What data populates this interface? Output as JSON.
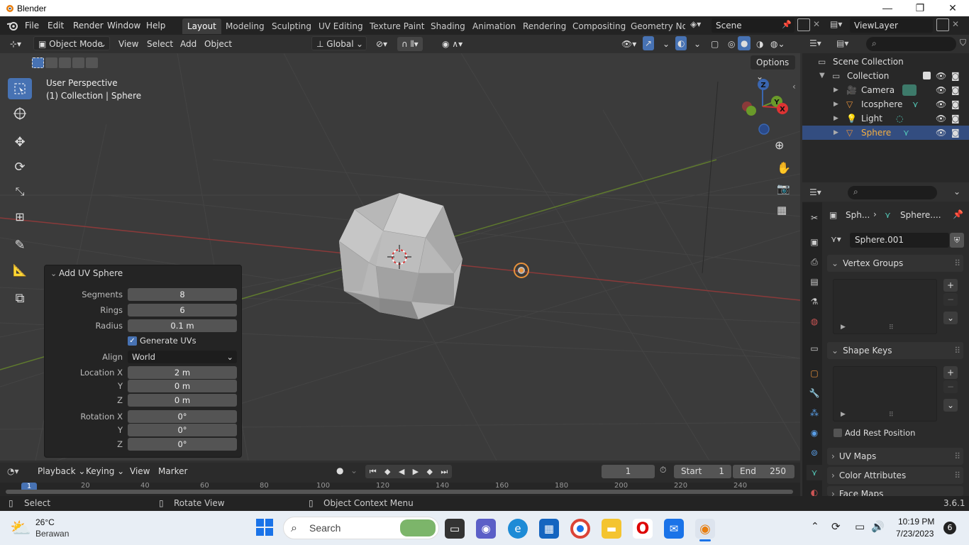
{
  "window": {
    "title": "Blender",
    "min": "—",
    "max": "❐",
    "close": "✕"
  },
  "menu": [
    "File",
    "Edit",
    "Render",
    "Window",
    "Help"
  ],
  "workspaces": [
    "Layout",
    "Modeling",
    "Sculpting",
    "UV Editing",
    "Texture Paint",
    "Shading",
    "Animation",
    "Rendering",
    "Compositing",
    "Geometry Noc"
  ],
  "active_workspace": "Layout",
  "scene": {
    "name": "Scene",
    "view_layer": "ViewLayer"
  },
  "viewport_header": {
    "mode": "Object Mode",
    "menus": [
      "View",
      "Select",
      "Add",
      "Object"
    ],
    "orientation": "Global",
    "options": "Options"
  },
  "overlay_text": {
    "line1": "User Perspective",
    "line2": "(1) Collection | Sphere"
  },
  "gizmo": {
    "x": "X",
    "y": "Y",
    "z": "Z"
  },
  "redo_panel": {
    "title": "Add UV Sphere",
    "segments_label": "Segments",
    "segments": "8",
    "rings_label": "Rings",
    "rings": "6",
    "radius_label": "Radius",
    "radius": "0.1 m",
    "generate_uvs_label": "Generate UVs",
    "generate_uvs": true,
    "align_label": "Align",
    "align": "World",
    "location_label": "Location X",
    "loc_x": "2 m",
    "y_label": "Y",
    "loc_y": "0 m",
    "z_label": "Z",
    "loc_z": "0 m",
    "rotation_label": "Rotation X",
    "rot_x": "0°",
    "rot_y": "0°",
    "rot_z": "0°"
  },
  "outliner": {
    "root": "Scene Collection",
    "collection": "Collection",
    "items": [
      "Camera",
      "Icosphere",
      "Light",
      "Sphere"
    ],
    "selected": "Sphere"
  },
  "properties": {
    "breadcrumb_obj": "Sph...",
    "breadcrumb_data": "Sphere....",
    "mesh_name": "Sphere.001",
    "panels": {
      "vertex_groups": "Vertex Groups",
      "shape_keys": "Shape Keys",
      "add_rest_position": "Add Rest Position",
      "uv_maps": "UV Maps",
      "color_attributes": "Color Attributes",
      "face_maps": "Face Maps"
    }
  },
  "timeline": {
    "menus": [
      "Playback",
      "Keying",
      "View",
      "Marker"
    ],
    "current_frame": "1",
    "start_label": "Start",
    "start": "1",
    "end_label": "End",
    "end": "250",
    "ruler": [
      "1",
      "20",
      "40",
      "60",
      "80",
      "100",
      "120",
      "140",
      "160",
      "180",
      "200",
      "220",
      "240"
    ]
  },
  "statusbar": {
    "select": "Select",
    "rotate": "Rotate View",
    "context": "Object Context Menu",
    "version": "3.6.1"
  },
  "taskbar": {
    "temp": "26°C",
    "weather": "Berawan",
    "search": "Search",
    "time": "10:19 PM",
    "date": "7/23/2023",
    "badge": "6"
  },
  "colors": {
    "accent": "#4772b3",
    "selection": "#334d80",
    "orange": "#e8923b"
  }
}
